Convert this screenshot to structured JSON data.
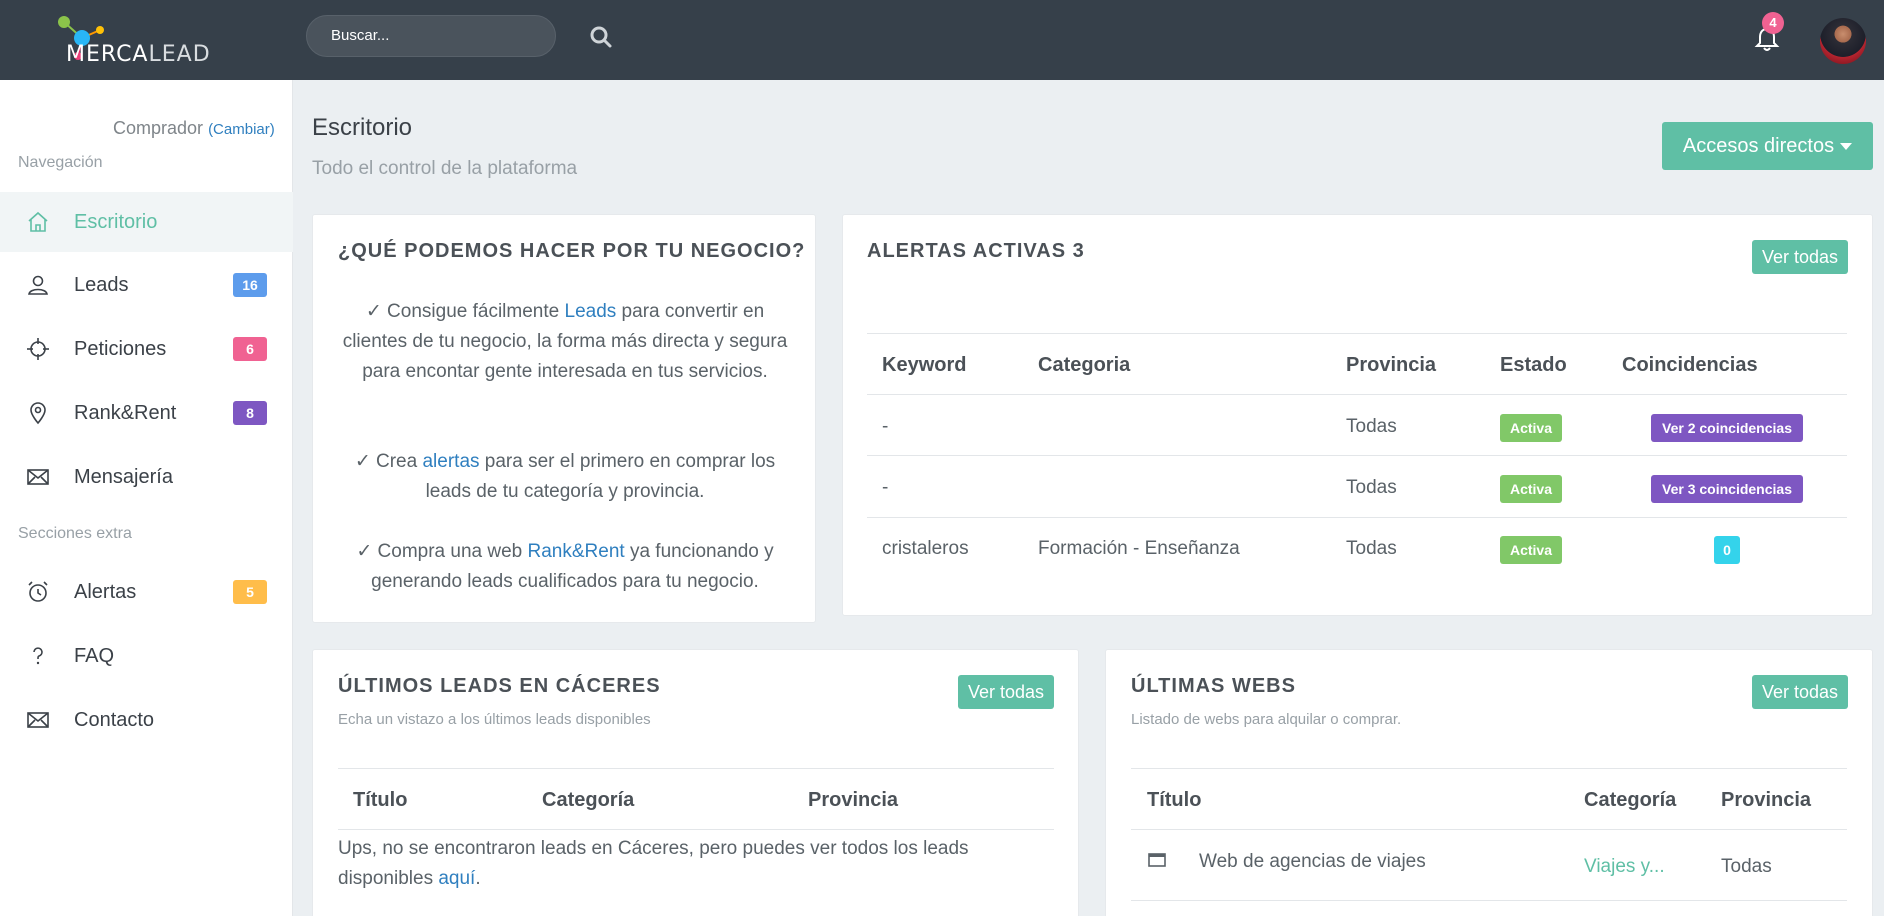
{
  "brand": {
    "name_bold": "MERCA",
    "name_thin": "LEAD"
  },
  "header": {
    "search_placeholder": "Buscar...",
    "notifications_count": "4"
  },
  "sidebar": {
    "role": "Comprador",
    "change_label": "(Cambiar)",
    "nav_title": "Navegación",
    "extra_title": "Secciones extra",
    "items": [
      {
        "label": "Escritorio",
        "badge": ""
      },
      {
        "label": "Leads",
        "badge": "16"
      },
      {
        "label": "Peticiones",
        "badge": "6"
      },
      {
        "label": "Rank&Rent",
        "badge": "8"
      },
      {
        "label": "Mensajería",
        "badge": ""
      },
      {
        "label": "Alertas",
        "badge": "5"
      },
      {
        "label": "FAQ",
        "badge": ""
      },
      {
        "label": "Contacto",
        "badge": ""
      }
    ]
  },
  "page": {
    "title": "Escritorio",
    "subtitle": "Todo el control de la plataforma",
    "quick_access": "Accesos directos"
  },
  "business": {
    "title": "¿QUÉ PODEMOS HACER POR TU NEGOCIO?",
    "b1_pre": "✓ Consigue fácilmente ",
    "b1_link": "Leads",
    "b1_post": " para convertir en clientes de tu negocio, la forma más directa y segura para encontar gente interesada en tus servicios.",
    "b2_pre": "✓ Crea ",
    "b2_link": "alertas",
    "b2_post": " para ser el primero en comprar los leads de tu categoría y provincia.",
    "b3_pre": "✓ Compra una web ",
    "b3_link": "Rank&Rent",
    "b3_post": " ya funcionando y generando leads cualificados para tu negocio."
  },
  "alerts": {
    "title": "ALERTAS ACTIVAS 3",
    "view_all": "Ver todas",
    "columns": [
      "Keyword",
      "Categoria",
      "Provincia",
      "Estado",
      "Coincidencias"
    ],
    "rows": [
      {
        "keyword": "-",
        "category": "",
        "province": "Todas",
        "state": "Activa",
        "matches": "Ver 2 coincidencias"
      },
      {
        "keyword": "-",
        "category": "",
        "province": "Todas",
        "state": "Activa",
        "matches": "Ver 3 coincidencias"
      },
      {
        "keyword": "cristaleros",
        "category": "Formación - Enseñanza",
        "province": "Todas",
        "state": "Activa",
        "matches": "0"
      }
    ]
  },
  "leads": {
    "title": "ÚLTIMOS LEADS EN CÁCERES",
    "subtitle": "Echa un vistazo a los últimos leads disponibles",
    "view_all": "Ver todas",
    "columns": [
      "Título",
      "Categoría",
      "Provincia"
    ],
    "empty_pre": "Ups, no se encontraron leads en Cáceres, pero puedes ver todos los leads disponibles ",
    "empty_link": "aquí",
    "empty_post": "."
  },
  "webs": {
    "title": "ÚLTIMAS WEBS",
    "subtitle": "Listado de webs para alquilar o comprar.",
    "view_all": "Ver todas",
    "columns": [
      "Título",
      "Categoría",
      "Provincia"
    ],
    "rows": [
      {
        "title": "Web de agencias de viajes",
        "category": "Viajes y...",
        "province": "Todas"
      }
    ]
  },
  "colors": {
    "topbar": "#36404a",
    "accent": "#5fbfa5",
    "badge_blue": "#5d9cec",
    "badge_pink": "#f06292",
    "badge_purple": "#7e57c2",
    "badge_yellow": "#ffbd4a"
  }
}
